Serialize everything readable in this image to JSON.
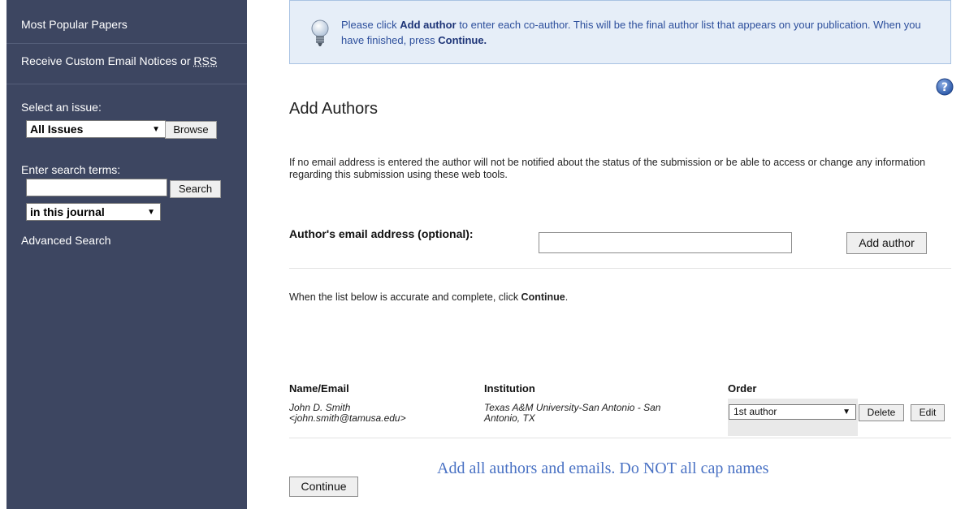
{
  "sidebar": {
    "most_popular": "Most Popular Papers",
    "custom_email": "Receive Custom Email Notices or ",
    "rss": "RSS",
    "select_issue_label": "Select an issue:",
    "issue_select": "All Issues",
    "browse_label": "Browse",
    "search_terms_label": "Enter search terms:",
    "search_value": "",
    "search_label": "Search",
    "scope_select": "in this journal",
    "advanced_search": "Advanced Search"
  },
  "notice": {
    "text_before": "Please click ",
    "add_author": "Add author",
    "text_middle": " to enter each co-author. This will be the final author list that appears on your publication. When you have finished, press ",
    "continue": "Continue."
  },
  "main": {
    "title": "Add Authors",
    "info": "If no email address is entered the author will not be notified about the status of the submission or be able to access or change any information regarding this submission using these web tools.",
    "email_label": "Author's email address (optional):",
    "email_value": "",
    "add_author_button": "Add author",
    "list_instruction_before": "When the list below is accurate and complete, click ",
    "list_instruction_bold": "Continue",
    "list_instruction_after": "."
  },
  "table": {
    "headers": [
      "Name/Email",
      "Institution",
      "Order"
    ],
    "rows": [
      {
        "name": "John D. Smith",
        "email": "<john.smith@tamusa.edu>",
        "institution_line1": "Texas A&M University-San Antonio - San",
        "institution_line2": "Antonio, TX",
        "order": "1st author",
        "delete_label": "Delete",
        "edit_label": "Edit"
      }
    ]
  },
  "continue_button": "Continue",
  "annotation": "Add all authors and emails. Do NOT all cap names",
  "colors": {
    "sidebar_bg": "#3d4661",
    "notice_bg": "#e6eef8",
    "notice_text": "#2d4f9c",
    "annotation": "#4a72c4"
  },
  "icons": [
    "lightbulb-icon",
    "help-icon",
    "dropdown-arrow-icon"
  ]
}
